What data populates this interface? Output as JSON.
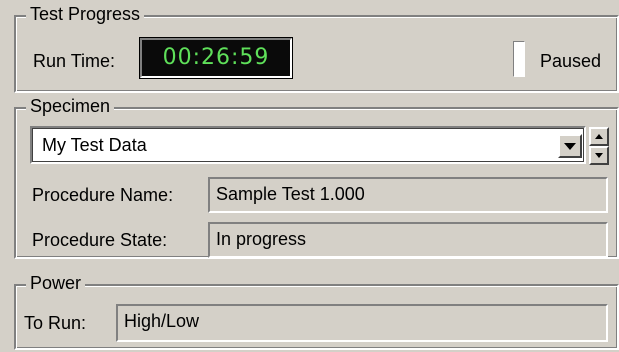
{
  "test_progress": {
    "title": "Test Progress",
    "run_time_label": "Run Time:",
    "run_time_value": "00:26:59",
    "paused_label": "Paused",
    "lcd_color": "#5fe05a"
  },
  "specimen": {
    "title": "Specimen",
    "selected": "My Test Data",
    "procedure_name_label": "Procedure Name:",
    "procedure_name_value": "Sample Test 1.000",
    "procedure_state_label": "Procedure State:",
    "procedure_state_value": "In progress"
  },
  "power": {
    "title": "Power",
    "to_run_label": "To Run:",
    "to_run_value": "High/Low"
  },
  "icons": {
    "dropdown": "chevron-down-icon",
    "spin_up": "spin-up-icon",
    "spin_down": "spin-down-icon"
  }
}
